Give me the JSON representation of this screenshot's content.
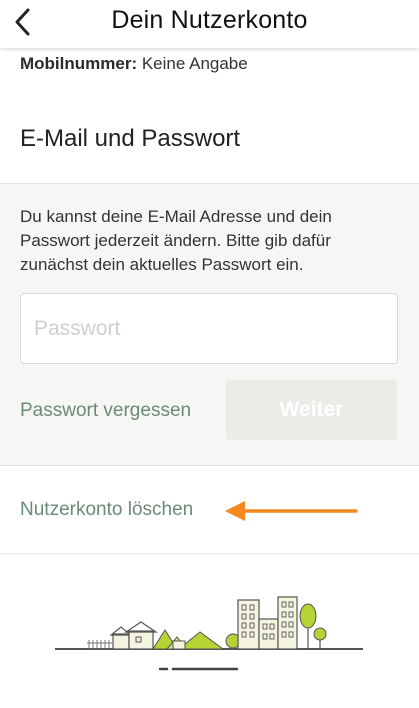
{
  "header": {
    "title": "Dein Nutzerkonto",
    "back_icon": "chevron-left-icon"
  },
  "profile": {
    "mobile_label": "Mobilnummer:",
    "mobile_value": "Keine Angabe"
  },
  "section": {
    "title": "E-Mail und Passwort",
    "info_text": "Du kannst deine E-Mail Adresse und dein Passwort jederzeit ändern. Bitte gib dafür zunächst dein aktuelles Passwort ein.",
    "password_placeholder": "Passwort",
    "password_value": "",
    "forgot_label": "Passwort vergessen",
    "next_label": "Weiter"
  },
  "account": {
    "delete_label": "Nutzerkonto löschen"
  },
  "colors": {
    "link_green": "#6c8a78",
    "arrow_orange": "#f5891f",
    "button_disabled": "#ebebe8",
    "panel_bg": "#f6f6f4",
    "illustration_green": "#b5d334"
  }
}
